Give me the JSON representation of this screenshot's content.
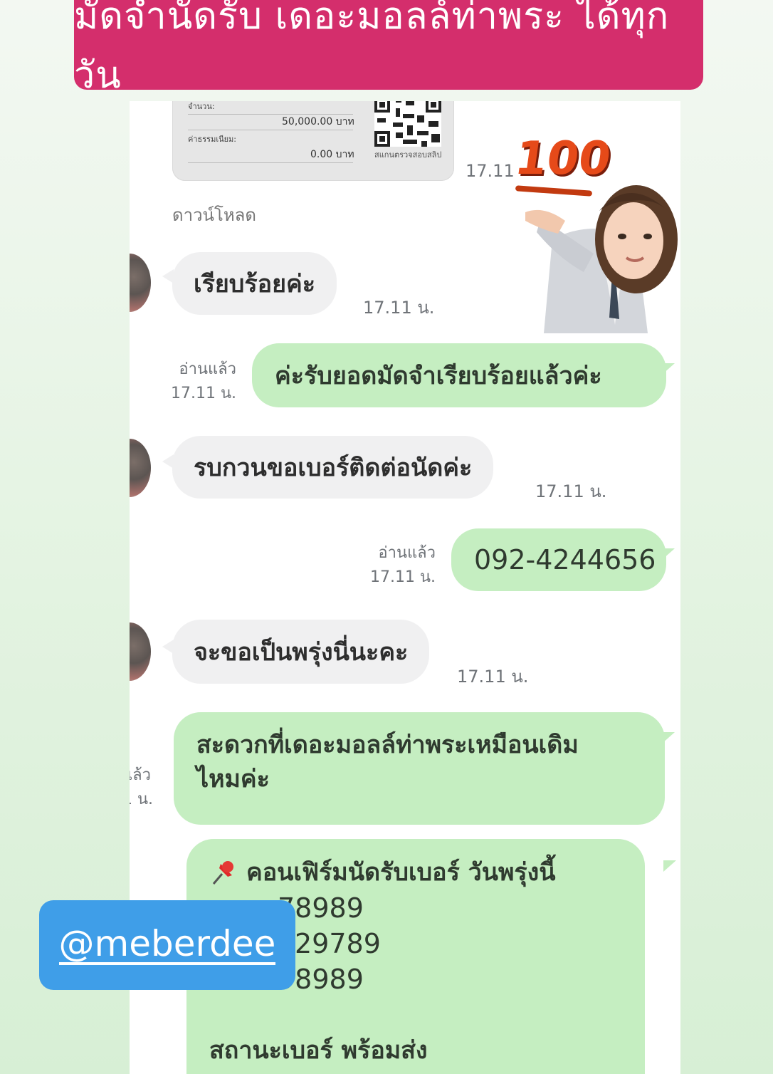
{
  "banner": {
    "text": "มัดจำนัดรับ เดอะมอลล์ท่าพระ ได้ทุกวัน"
  },
  "slip": {
    "amount_label": "จำนวน:",
    "amount_value": "50,000.00 บาท",
    "fee_label": "ค่าธรรมเนียม:",
    "fee_value": "0.00 บาท",
    "qr_caption": "สแกนตรวจสอบสลิป"
  },
  "slip_time": "17.11",
  "download_link": "ดาวน์โหลด",
  "sticker": {
    "badge": "100"
  },
  "messages": [
    {
      "text": "เรียบร้อยค่ะ",
      "time": "17.11 น."
    },
    {
      "text": "ค่ะรับยอดมัดจำเรียบร้อยแล้วค่ะ",
      "read": "อ่านแล้ว",
      "time": "17.11 น."
    },
    {
      "text": "รบกวนขอเบอร์ติดต่อนัดค่ะ",
      "time": "17.11 น."
    },
    {
      "text": "092-4244656",
      "read": "อ่านแล้ว",
      "time": "17.11 น."
    },
    {
      "text": "จะขอเป็นพรุ่งนี่นะคะ",
      "time": "17.11 น."
    },
    {
      "line1": "สะดวกที่เดอะมอลล์ท่าพระเหมือนเดิม",
      "line2": "ไหมค่ะ",
      "read": "แล้ว",
      "time": "1 น."
    },
    {
      "line1": "คอนเฟิร์มนัดรับเบอร์ วันพรุ่งนี้",
      "line2": "78989",
      "line3": "29789",
      "line4": "98989",
      "line6": "สถานะเบอร์ พร้อมส่ง"
    }
  ],
  "tag": {
    "handle": "@meberdee"
  },
  "icons": {
    "pin": "pushpin-icon"
  }
}
